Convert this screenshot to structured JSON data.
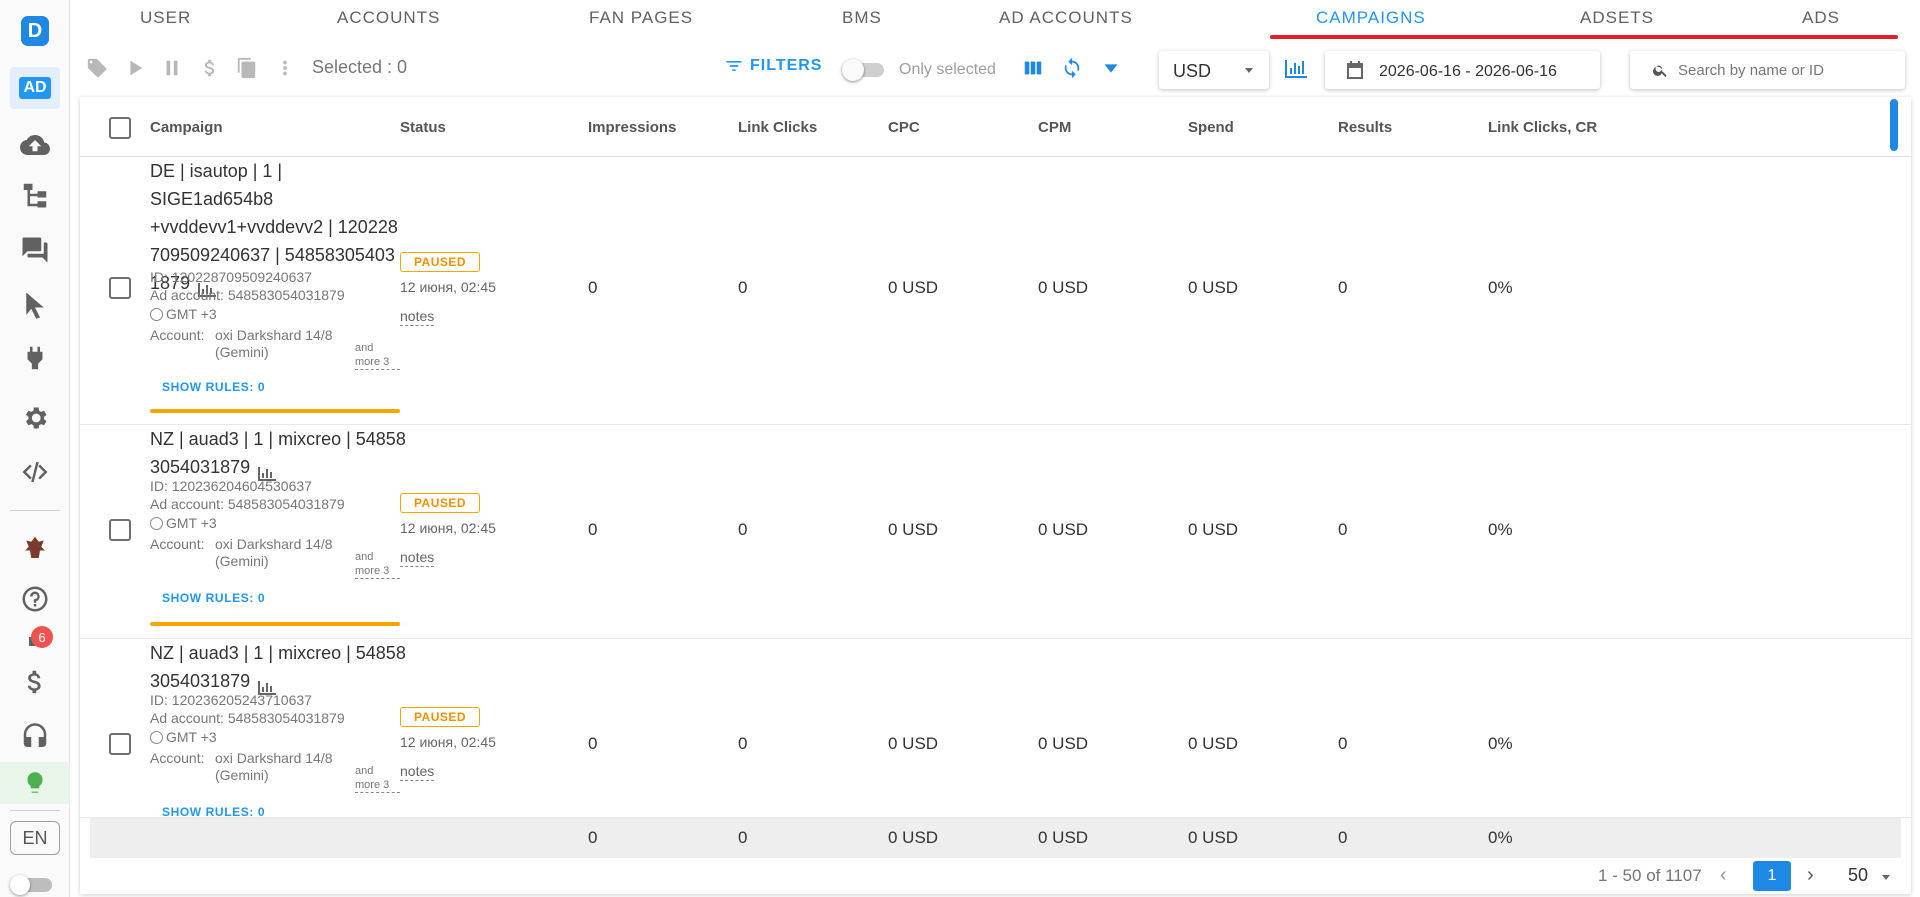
{
  "sidebar": {
    "logo_letter": "D",
    "ad_label": "AD",
    "notifications_count": "6",
    "language": "EN"
  },
  "tabs": [
    "USER",
    "ACCOUNTS",
    "FAN PAGES",
    "BMS",
    "AD ACCOUNTS",
    "CAMPAIGNS",
    "ADSETS",
    "ADS"
  ],
  "active_tab": "CAMPAIGNS",
  "toolbar": {
    "selected_text": "Selected : 0",
    "filters_label": "FILTERS",
    "only_selected_label": "Only selected",
    "currency": "USD",
    "date_range": "2026-06-16 - 2026-06-16",
    "search_placeholder": "Search by name or ID"
  },
  "table": {
    "columns": [
      "Campaign",
      "Status",
      "Impressions",
      "Link Clicks",
      "CPC",
      "CPM",
      "Spend",
      "Results",
      "Link Clicks, CR"
    ],
    "rows": [
      {
        "name": "DE | isautop | 1 | SIGE1ad654b8 +vvddevv1+vvddevv2 | 120228 709509240637 | 54858305403 1879",
        "id": "ID: 120228709509240637",
        "ad_account": "Ad account: 548583054031879",
        "timezone": "GMT +3",
        "account_label": "Account:",
        "account_value": "oxi Darkshard 14/8 (Gemini)",
        "more": "and more 3",
        "rules": "SHOW RULES: 0",
        "status": "PAUSED",
        "status_date": "12 июня, 02:45",
        "notes": "notes",
        "impressions": "0",
        "link_clicks": "0",
        "cpc": "0 USD",
        "cpm": "0 USD",
        "spend": "0 USD",
        "results": "0",
        "cr": "0%"
      },
      {
        "name": "NZ | auad3 | 1 | mixcreo | 54858 3054031879",
        "id": "ID: 120236204604530637",
        "ad_account": "Ad account: 548583054031879",
        "timezone": "GMT +3",
        "account_label": "Account:",
        "account_value": "oxi Darkshard 14/8 (Gemini)",
        "more": "and more 3",
        "rules": "SHOW RULES: 0",
        "status": "PAUSED",
        "status_date": "12 июня, 02:45",
        "notes": "notes",
        "impressions": "0",
        "link_clicks": "0",
        "cpc": "0 USD",
        "cpm": "0 USD",
        "spend": "0 USD",
        "results": "0",
        "cr": "0%"
      },
      {
        "name": "NZ | auad3 | 1 | mixcreo | 54858 3054031879",
        "id": "ID: 120236205243710637",
        "ad_account": "Ad account: 548583054031879",
        "timezone": "GMT +3",
        "account_label": "Account:",
        "account_value": "oxi Darkshard 14/8 (Gemini)",
        "more": "and more 3",
        "rules": "SHOW RULES: 0",
        "status": "PAUSED",
        "status_date": "12 июня, 02:45",
        "notes": "notes",
        "impressions": "0",
        "link_clicks": "0",
        "cpc": "0 USD",
        "cpm": "0 USD",
        "spend": "0 USD",
        "results": "0",
        "cr": "0%"
      }
    ],
    "totals": {
      "impressions": "0",
      "link_clicks": "0",
      "cpc": "0 USD",
      "cpm": "0 USD",
      "spend": "0 USD",
      "results": "0",
      "cr": "0%"
    }
  },
  "pagination": {
    "range": "1 - 50 of 1107",
    "current_page": "1",
    "page_size": "50"
  },
  "colors": {
    "accent": "#2196f3",
    "paused": "#f7a600",
    "highlight_line": "#e41f2b",
    "badge": "#ef5350"
  }
}
